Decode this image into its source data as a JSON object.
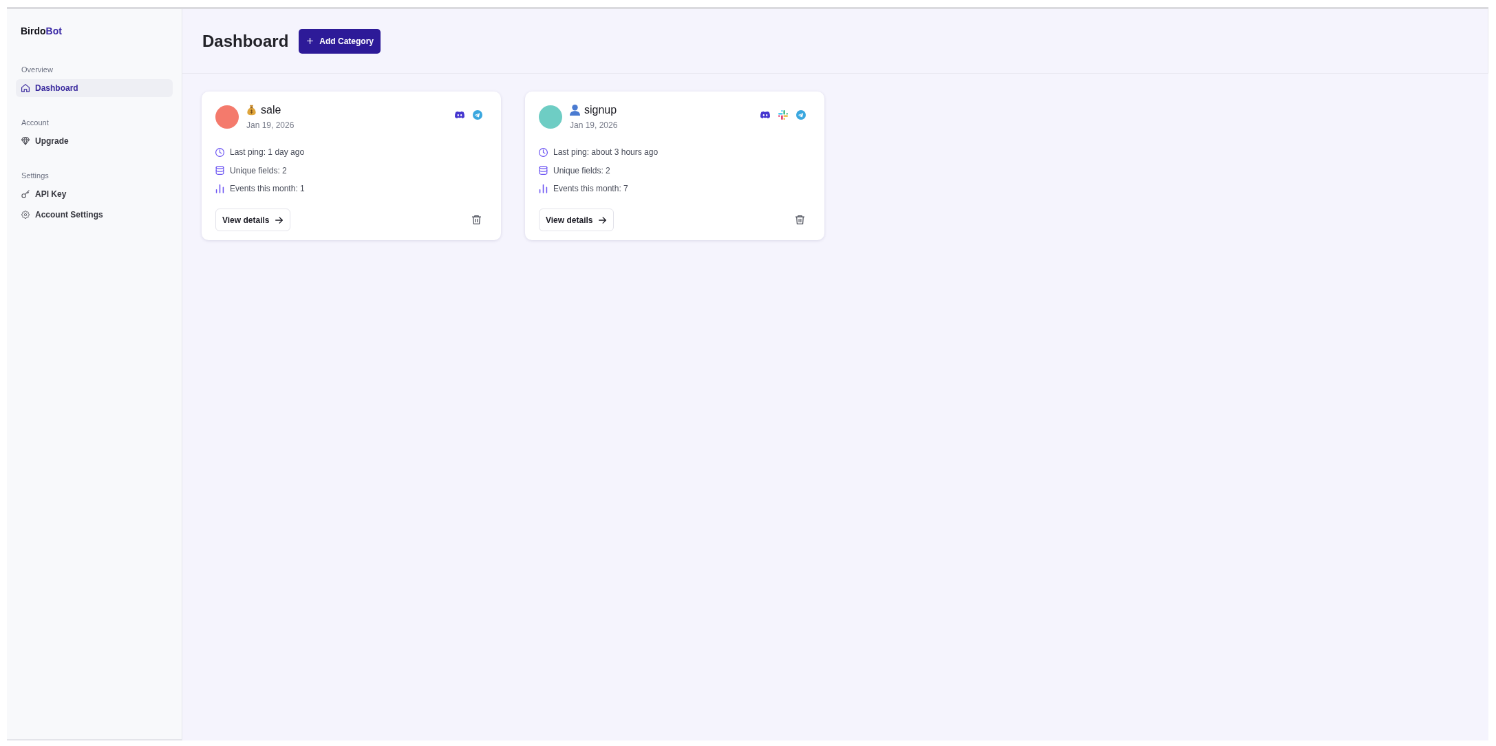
{
  "sidebar": {
    "logo": {
      "text": "Birdo",
      "accent": "Bot"
    },
    "sections": [
      {
        "heading": "Overview",
        "items": [
          {
            "label": "Dashboard",
            "kind": "house",
            "selected": true
          }
        ]
      },
      {
        "heading": "Account",
        "items": [
          {
            "label": "Upgrade",
            "kind": "diamond",
            "selected": false
          }
        ]
      },
      {
        "heading": "Settings",
        "items": [
          {
            "label": "API Key",
            "kind": "key",
            "selected": false
          },
          {
            "label": "Account Settings",
            "kind": "gear",
            "selected": false
          }
        ]
      }
    ]
  },
  "header": {
    "title": "Dashboard",
    "action": {
      "label": "Add Category"
    }
  },
  "categories": [
    {
      "name": "sale",
      "kind": "money_bag",
      "color": "#f47a6c",
      "date": "Jan 19, 2026",
      "channels": [
        {
          "kind": "discord"
        },
        {
          "kind": "telegram"
        }
      ],
      "stats": [
        {
          "kind": "ping",
          "text": "Last ping: 1 day ago"
        },
        {
          "kind": "fields",
          "text": "Unique fields: 2"
        },
        {
          "kind": "events",
          "text": "Events this month: 1"
        }
      ],
      "button": "View details"
    },
    {
      "name": "signup",
      "kind": "person",
      "color": "#6ecdc4",
      "date": "Jan 19, 2026",
      "channels": [
        {
          "kind": "discord"
        },
        {
          "kind": "slack"
        },
        {
          "kind": "telegram"
        }
      ],
      "stats": [
        {
          "kind": "ping",
          "text": "Last ping: about 3 hours ago"
        },
        {
          "kind": "fields",
          "text": "Unique fields: 2"
        },
        {
          "kind": "events",
          "text": "Events this month: 7"
        }
      ],
      "button": "View details"
    }
  ]
}
